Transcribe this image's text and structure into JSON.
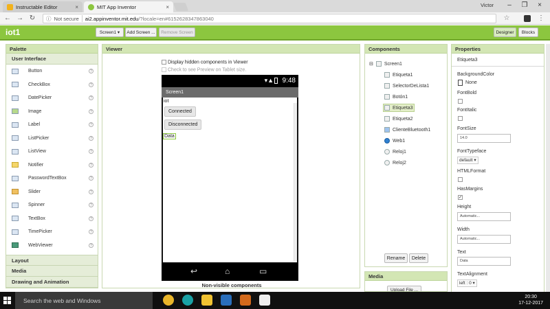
{
  "browser": {
    "tabs": [
      {
        "title": "Instructable Editor",
        "active": false
      },
      {
        "title": "MIT App Inventor",
        "active": true
      }
    ],
    "user": "Victor",
    "url": {
      "security": "Not secure",
      "host": "ai2.appinventor.mit.edu",
      "path": "/?locale=en#6152628347863040"
    }
  },
  "app": {
    "project": "iot1",
    "screen_select": "Screen1 ▾",
    "add_screen": "Add Screen ...",
    "remove_screen": "Remove Screen",
    "designer": "Designer",
    "blocks": "Blocks"
  },
  "palette": {
    "title": "Palette",
    "category": "User Interface",
    "items": [
      "Button",
      "CheckBox",
      "DatePicker",
      "Image",
      "Label",
      "ListPicker",
      "ListView",
      "Notifier",
      "PasswordTextBox",
      "Slider",
      "Spinner",
      "TextBox",
      "TimePicker",
      "WebViewer"
    ],
    "help": "?",
    "other_categories": [
      "Layout",
      "Media",
      "Drawing and Animation"
    ]
  },
  "viewer": {
    "title": "Viewer",
    "display_hidden": "Display hidden components in Viewer",
    "tablet_preview": "Check to see Preview on Tablet size.",
    "phone": {
      "time": "9:48",
      "screen_title": "Screen1",
      "label": "iot",
      "button1": "Connected",
      "button2": "Disconnected",
      "selected_label": "Data",
      "nav_back": "↩",
      "nav_home": "⌂",
      "nav_recent": "▭"
    },
    "nonvisible": "Non-visible components"
  },
  "components": {
    "title": "Components",
    "root": "Screen1",
    "items": [
      "Etiqueta1",
      "SelectorDeLista1",
      "Botón1",
      "Etiqueta3",
      "Etiqueta2",
      "ClienteBluetooth1",
      "Web1",
      "Reloj1",
      "Reloj2"
    ],
    "selected": "Etiqueta3",
    "rename": "Rename",
    "delete": "Delete"
  },
  "media": {
    "title": "Media",
    "upload": "Upload File ..."
  },
  "properties": {
    "title": "Properties",
    "component": "Etiqueta3",
    "background_color_label": "BackgroundColor",
    "background_color_value": "None",
    "font_bold": "FontBold",
    "font_italic": "FontItalic",
    "font_size_label": "FontSize",
    "font_size_value": "14.0",
    "font_typeface_label": "FontTypeface",
    "font_typeface_value": "default ▾",
    "html_format": "HTMLFormat",
    "has_margins": "HasMargins",
    "height_label": "Height",
    "height_value": "Automatic...",
    "width_label": "Width",
    "width_value": "Automatic...",
    "text_label": "Text",
    "text_value": "Data",
    "text_alignment_label": "TextAlignment",
    "text_alignment_value": "left : 0 ▾"
  },
  "taskbar": {
    "search": "Search the web and Windows",
    "time": "20:30",
    "date": "17-12-2017"
  }
}
